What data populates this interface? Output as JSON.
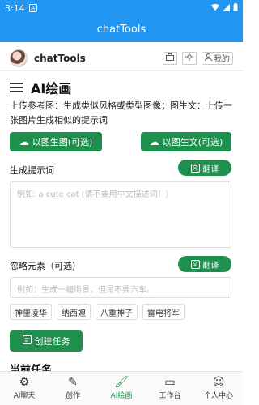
{
  "status_bar": {
    "time": "3:14",
    "notice_icon": "A"
  },
  "app_bar": {
    "title": "chatTools"
  },
  "brand": {
    "name": "chatTools",
    "mine_label": "我的"
  },
  "page": {
    "title": "AI绘画",
    "description": "上传参考图：生成类似风格或类型图像；图生文：上传一张图片生成相似的提示词"
  },
  "buttons": {
    "img2img": "以图生图(可选)",
    "img2text": "以图生文(可选)",
    "translate": "翻译",
    "create_task": "创建任务"
  },
  "prompt": {
    "label": "生成提示词",
    "placeholder": "例如:  a cute cat (请不要用中文描述词！)"
  },
  "negative": {
    "label": "忽略元素（可选）",
    "placeholder": "例如：生成一幅街景，但是不要汽车。"
  },
  "tags": [
    "神里凌华",
    "纳西妲",
    "八重神子",
    "雷电将军"
  ],
  "current_task_label": "当前任务",
  "nav": [
    "AI聊天",
    "创作",
    "AI绘画",
    "工作台",
    "个人中心"
  ],
  "colors": {
    "primary": "#2196f3",
    "accent_green": "#1f8f4e"
  },
  "icons": {
    "nav": [
      "gear-icon",
      "edit-icon",
      "brush-icon",
      "monitor-icon",
      "person-icon"
    ]
  }
}
